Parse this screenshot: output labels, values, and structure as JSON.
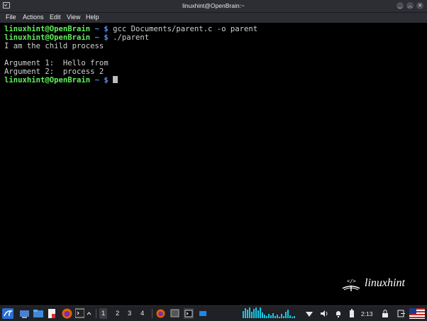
{
  "window": {
    "title": "linuxhint@OpenBrain:~",
    "min_glyph": "‿",
    "max_glyph": "︿",
    "close_glyph": "✕"
  },
  "menu": [
    "File",
    "Actions",
    "Edit",
    "View",
    "Help"
  ],
  "terminal": {
    "lines": [
      {
        "prompt": "linuxhint@OpenBrain",
        "symbol": " ~ $ ",
        "cmd": "gcc Documents/parent.c -o parent"
      },
      {
        "prompt": "linuxhint@OpenBrain",
        "symbol": " ~ $ ",
        "cmd": "./parent"
      },
      {
        "text": "I am the child process"
      },
      {
        "text": ""
      },
      {
        "text": "Argument 1:  Hello from"
      },
      {
        "text": "Argument 2:  process 2"
      },
      {
        "prompt": "linuxhint@OpenBrain",
        "symbol": " ~ $ ",
        "cmd": ""
      }
    ]
  },
  "watermark": {
    "text": "linuxhint",
    "badge": "</>"
  },
  "taskbar": {
    "workspaces": [
      "1",
      "2",
      "3",
      "4"
    ],
    "active_workspace": "1",
    "clock": "2:13",
    "icons": [
      "kali-menu-icon",
      "desktop-icon",
      "file-manager-icon",
      "text-editor-icon",
      "firefox-icon",
      "terminal-icon",
      "chevron-up-icon",
      "firefox-task-icon",
      "terminal-task-icon",
      "window-task-icon",
      "network-icon",
      "volume-icon",
      "notification-icon",
      "battery-icon",
      "lock-icon",
      "flag-icon"
    ],
    "accent": "#18c7e6"
  },
  "colors": {
    "prompt": "#5ef25a",
    "symbol": "#5a8cf0",
    "text": "#d0d0d0",
    "background": "#000000",
    "titlebar": "#2c2e33"
  }
}
